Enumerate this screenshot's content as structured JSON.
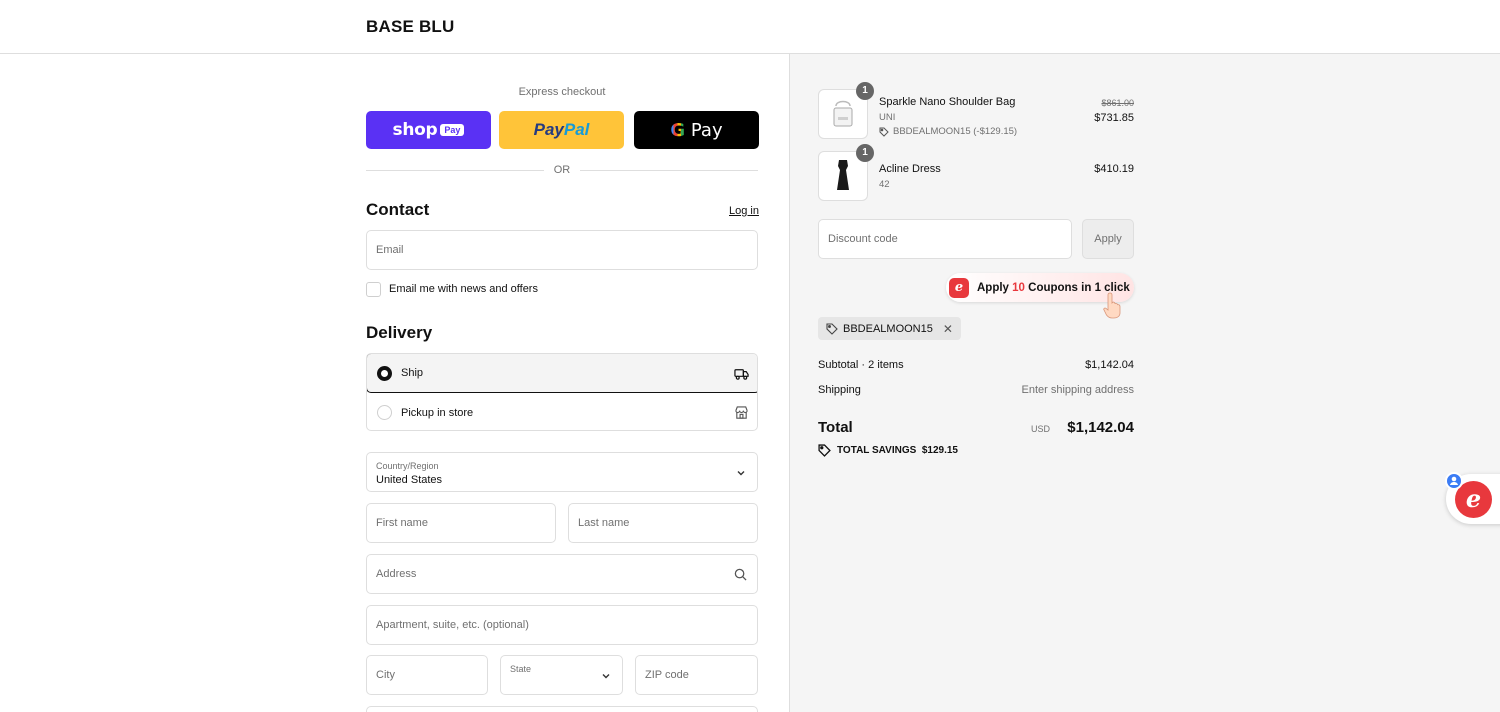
{
  "header": {
    "brand": "BASE BLU"
  },
  "express": {
    "label": "Express checkout",
    "shop_word": "shop",
    "shop_pay": "Pay",
    "paypal_1": "Pay",
    "paypal_2": "Pal",
    "gpay_g": "G",
    "gpay_word": " Pay",
    "or": "OR"
  },
  "contact": {
    "title": "Contact",
    "login": "Log in",
    "email_placeholder": "Email",
    "news_label": "Email me with news and offers"
  },
  "delivery": {
    "title": "Delivery",
    "options": [
      {
        "label": "Ship",
        "selected": true
      },
      {
        "label": "Pickup in store",
        "selected": false
      }
    ],
    "country_label": "Country/Region",
    "country_value": "United States",
    "first_name": "First name",
    "last_name": "Last name",
    "address": "Address",
    "apartment": "Apartment, suite, etc. (optional)",
    "city": "City",
    "state": "State",
    "zip": "ZIP code"
  },
  "cart": {
    "items": [
      {
        "name": "Sparkle Nano Shoulder Bag",
        "variant": "UNI",
        "discount": "BBDEALMOON15 (-$129.15)",
        "old_price": "$861.00",
        "price": "$731.85",
        "qty": "1"
      },
      {
        "name": "Acline Dress",
        "variant": "42",
        "price": "$410.19",
        "qty": "1"
      }
    ],
    "discount_placeholder": "Discount code",
    "apply": "Apply",
    "coupon_pre": "Apply ",
    "coupon_num": "10",
    "coupon_post": " Coupons in 1 click",
    "coupon_logo": "e",
    "applied_code": "BBDEALMOON15",
    "subtotal_label": "Subtotal · 2 items",
    "subtotal_value": "$1,142.04",
    "shipping_label": "Shipping",
    "shipping_value": "Enter shipping address",
    "total_label": "Total",
    "total_currency": "USD",
    "total_value": "$1,142.04",
    "savings": "TOTAL SAVINGS  $129.15"
  },
  "float_ext": {
    "logo": "e"
  },
  "colors": {
    "shop": "#5a31f4",
    "paypal": "#ffc439",
    "gpay": "#000000",
    "coupon_accent": "#e8383d"
  }
}
